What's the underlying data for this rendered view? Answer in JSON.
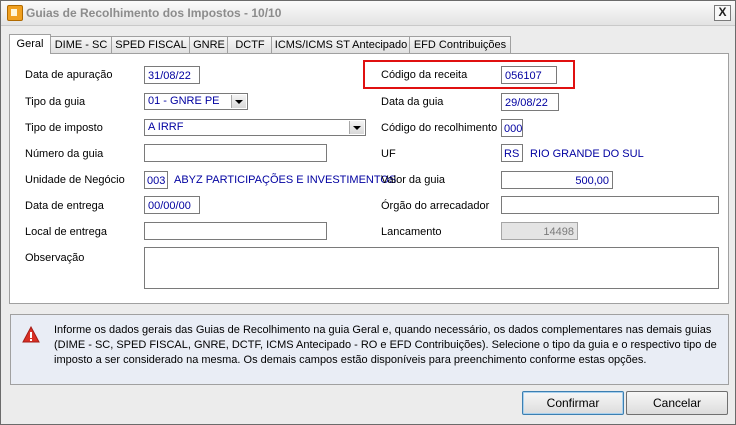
{
  "window": {
    "title": "Guias de Recolhimento dos Impostos - 10/10",
    "close_label": "X"
  },
  "tabs": [
    {
      "label": "Geral",
      "active": true
    },
    {
      "label": "DIME - SC"
    },
    {
      "label": "SPED FISCAL"
    },
    {
      "label": "GNRE"
    },
    {
      "label": "DCTF"
    },
    {
      "label": "ICMS/ICMS ST Antecipado"
    },
    {
      "label": "EFD Contribuições"
    }
  ],
  "form": {
    "data_apuracao": {
      "label": "Data de apuração",
      "value": "31/08/22"
    },
    "tipo_guia": {
      "label": "Tipo da guia",
      "value": "01 - GNRE PE"
    },
    "tipo_imposto": {
      "label": "Tipo de imposto",
      "value": "A IRRF"
    },
    "numero_guia": {
      "label": "Número da guia",
      "value": ""
    },
    "unidade_negocio": {
      "label": "Unidade de Negócio",
      "code": "003",
      "name": "ABYZ PARTICIPAÇÕES E INVESTIMENTOS"
    },
    "data_entrega": {
      "label": "Data de entrega",
      "value": "00/00/00"
    },
    "local_entrega": {
      "label": "Local de entrega",
      "value": ""
    },
    "observacao": {
      "label": "Observação",
      "value": ""
    },
    "codigo_receita": {
      "label": "Código da receita",
      "value": "056107"
    },
    "data_guia": {
      "label": "Data da guia",
      "value": "29/08/22"
    },
    "codigo_recolhimento": {
      "label": "Código do recolhimento",
      "value": "000"
    },
    "uf": {
      "label": "UF",
      "value": "RS",
      "name": "RIO GRANDE DO SUL"
    },
    "valor_guia": {
      "label": "Valor da guia",
      "value": "500,00"
    },
    "orgao_arrecadador": {
      "label": "Órgão do arrecadador",
      "value": ""
    },
    "lancamento": {
      "label": "Lancamento",
      "value": "14498"
    }
  },
  "info": {
    "text": "Informe os dados gerais das Guias de Recolhimento na guia Geral e, quando necessário, os dados complementares nas demais guias (DIME - SC, SPED FISCAL, GNRE, DCTF, ICMS Antecipado - RO e EFD Contribuições). Selecione o tipo da guia e o respectivo tipo de imposto a ser considerado na mesma. Os demais campos estão disponíveis para preenchimento conforme estas opções."
  },
  "buttons": {
    "confirm": "Confirmar",
    "cancel": "Cancelar"
  }
}
